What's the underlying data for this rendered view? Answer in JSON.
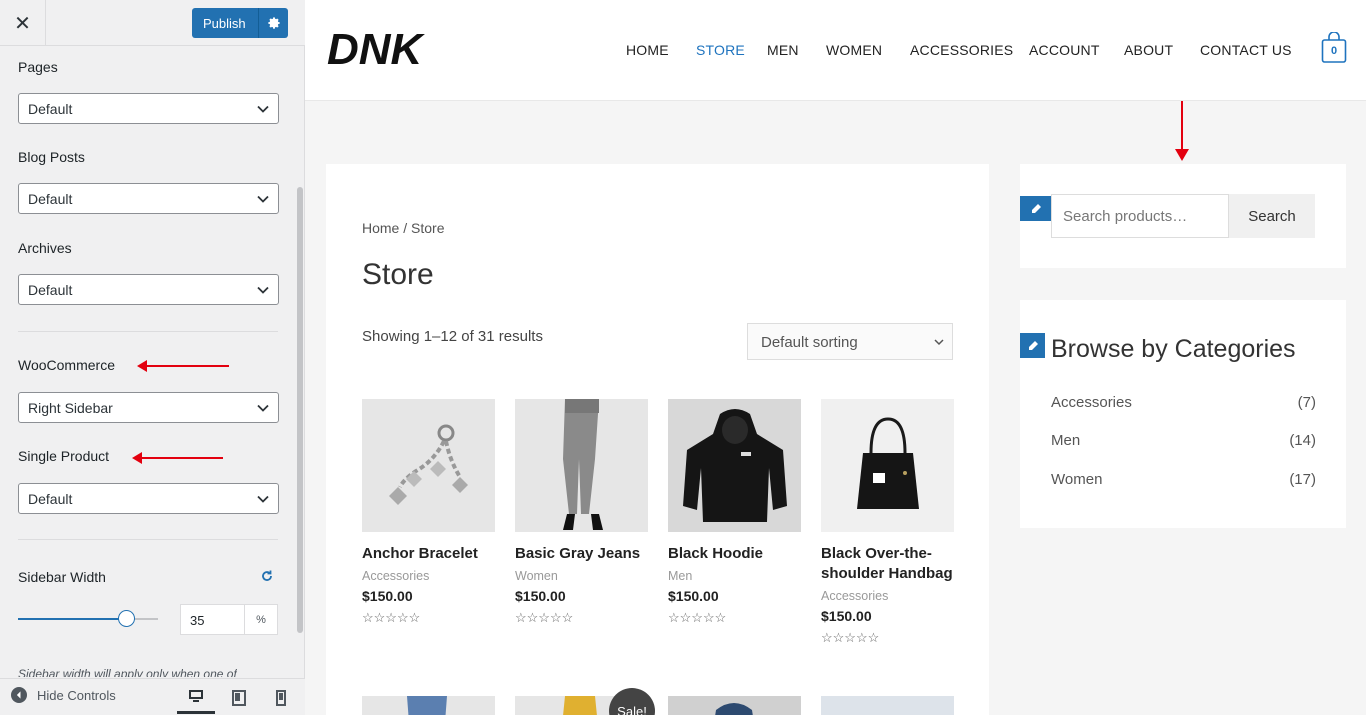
{
  "customizer": {
    "publish_label": "Publish",
    "sections": [
      {
        "label": "Pages",
        "value": "Default"
      },
      {
        "label": "Blog Posts",
        "value": "Default"
      },
      {
        "label": "Archives",
        "value": "Default"
      },
      {
        "label": "WooCommerce",
        "value": "Right Sidebar"
      },
      {
        "label": "Single Product",
        "value": "Default"
      }
    ],
    "sidebar_width_label": "Sidebar Width",
    "sidebar_width_value": "35",
    "sidebar_width_unit": "%",
    "sidebar_width_fraction": 0.77,
    "note": "Sidebar width will apply only when one of",
    "hide_controls": "Hide Controls"
  },
  "site": {
    "logo": "DNK",
    "nav": [
      "HOME",
      "STORE",
      "MEN",
      "WOMEN",
      "ACCESSORIES",
      "ACCOUNT",
      "ABOUT",
      "CONTACT US"
    ],
    "active_nav": "STORE",
    "cart_count": "0",
    "breadcrumb": "Home / Store",
    "title": "Store",
    "result_count": "Showing 1–12 of 31 results",
    "sorting": "Default sorting",
    "products": [
      {
        "name": "Anchor Bracelet",
        "category": "Accessories",
        "price": "$150.00",
        "stars": "☆☆☆☆☆"
      },
      {
        "name": "Basic Gray Jeans",
        "category": "Women",
        "price": "$150.00",
        "stars": "☆☆☆☆☆"
      },
      {
        "name": "Black Hoodie",
        "category": "Men",
        "price": "$150.00",
        "stars": "☆☆☆☆☆"
      },
      {
        "name": "Black Over-the-shoulder Handbag",
        "category": "Accessories",
        "price": "$150.00",
        "stars": "☆☆☆☆☆"
      }
    ],
    "sale_badge": "Sale!",
    "search_placeholder": "Search products…",
    "search_button": "Search",
    "categories_title": "Browse by Categories",
    "categories": [
      {
        "name": "Accessories",
        "count": "(7)"
      },
      {
        "name": "Men",
        "count": "(14)"
      },
      {
        "name": "Women",
        "count": "(17)"
      }
    ]
  },
  "colors": {
    "accent": "#2271b1",
    "nav_active": "#1e73be",
    "annotation_arrow": "#e3000f"
  }
}
